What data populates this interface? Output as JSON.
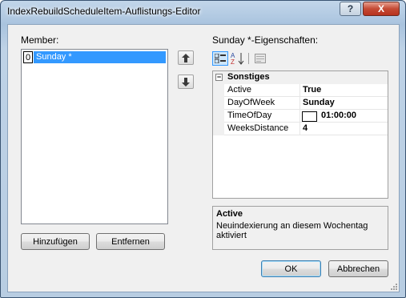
{
  "window": {
    "title": "IndexRebuildScheduleItem-Auflistungs-Editor"
  },
  "titlebar": {
    "help_glyph": "?",
    "close_glyph": "X"
  },
  "members": {
    "label": "Member:",
    "items": [
      {
        "index": "0",
        "name": "Sunday *"
      }
    ]
  },
  "properties": {
    "label": "Sunday *-Eigenschaften:",
    "category": "Sonstiges",
    "rows": [
      {
        "name": "Active",
        "value": "True"
      },
      {
        "name": "DayOfWeek",
        "value": "Sunday"
      },
      {
        "name": "TimeOfDay",
        "value": "01:00:00"
      },
      {
        "name": "WeeksDistance",
        "value": "4"
      }
    ],
    "description": {
      "title": "Active",
      "text": "Neuindexierung an diesem Wochentag aktiviert"
    }
  },
  "buttons": {
    "add": "Hinzufügen",
    "remove": "Entfernen",
    "ok": "OK",
    "cancel": "Abbrechen"
  },
  "icons": {
    "categorized": "categorized-icon",
    "alphabetical": "sort-alphabetical-icon",
    "property_pages": "property-pages-icon",
    "up": "arrow-up-icon",
    "down": "arrow-down-icon"
  }
}
